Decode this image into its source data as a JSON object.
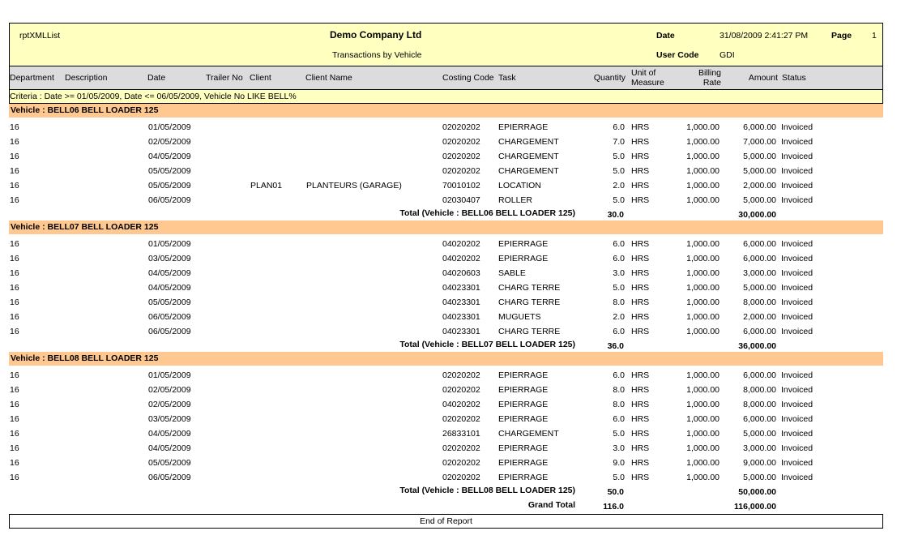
{
  "header": {
    "report_id": "rptXMLList",
    "company": "Demo Company Ltd",
    "subtitle": "Transactions by Vehicle",
    "date_label": "Date",
    "date_value": "31/08/2009 2:41:27 PM",
    "page_label": "Page",
    "page_value": "1",
    "user_label": "User Code",
    "user_value": "GDI"
  },
  "columns": {
    "department": "Department",
    "description": "Description",
    "date": "Date",
    "trailer": "Trailer No",
    "client": "Client",
    "client_name": "Client Name",
    "costing": "Costing Code",
    "task": "Task",
    "quantity": "Quantity",
    "uom_1": "Unit of",
    "uom_2": "Measure",
    "billing_1": "Billing",
    "billing_2": "Rate",
    "amount": "Amount",
    "status": "Status"
  },
  "criteria": "Criteria : Date >= 01/05/2009, Date <= 06/05/2009, Vehicle No LIKE BELL%",
  "groups": [
    {
      "title": "Vehicle : BELL06  BELL LOADER  125",
      "rows": [
        {
          "dept": "16",
          "date": "01/05/2009",
          "client": "",
          "client_name": "",
          "code": "02020202",
          "task": "EPIERRAGE",
          "qty": "6.0",
          "uom": "HRS",
          "rate": "1,000.00",
          "amount": "6,000.00",
          "status": "Invoiced"
        },
        {
          "dept": "16",
          "date": "02/05/2009",
          "client": "",
          "client_name": "",
          "code": "02020202",
          "task": "CHARGEMENT",
          "qty": "7.0",
          "uom": "HRS",
          "rate": "1,000.00",
          "amount": "7,000.00",
          "status": "Invoiced"
        },
        {
          "dept": "16",
          "date": "04/05/2009",
          "client": "",
          "client_name": "",
          "code": "02020202",
          "task": "CHARGEMENT",
          "qty": "5.0",
          "uom": "HRS",
          "rate": "1,000.00",
          "amount": "5,000.00",
          "status": "Invoiced"
        },
        {
          "dept": "16",
          "date": "05/05/2009",
          "client": "",
          "client_name": "",
          "code": "02020202",
          "task": "CHARGEMENT",
          "qty": "5.0",
          "uom": "HRS",
          "rate": "1,000.00",
          "amount": "5,000.00",
          "status": "Invoiced"
        },
        {
          "dept": "16",
          "date": "05/05/2009",
          "client": "PLAN01",
          "client_name": "PLANTEURS (GARAGE)",
          "code": "70010102",
          "task": "LOCATION",
          "qty": "2.0",
          "uom": "HRS",
          "rate": "1,000.00",
          "amount": "2,000.00",
          "status": "Invoiced"
        },
        {
          "dept": "16",
          "date": "06/05/2009",
          "client": "",
          "client_name": "",
          "code": "02030407",
          "task": "ROLLER",
          "qty": "5.0",
          "uom": "HRS",
          "rate": "1,000.00",
          "amount": "5,000.00",
          "status": "Invoiced"
        }
      ],
      "total_label": "Total (Vehicle : BELL06  BELL LOADER  125)",
      "total_qty": "30.0",
      "total_amount": "30,000.00"
    },
    {
      "title": "Vehicle : BELL07  BELL LOADER  125",
      "rows": [
        {
          "dept": "16",
          "date": "01/05/2009",
          "client": "",
          "client_name": "",
          "code": "04020202",
          "task": "EPIERRAGE",
          "qty": "6.0",
          "uom": "HRS",
          "rate": "1,000.00",
          "amount": "6,000.00",
          "status": "Invoiced"
        },
        {
          "dept": "16",
          "date": "03/05/2009",
          "client": "",
          "client_name": "",
          "code": "04020202",
          "task": "EPIERRAGE",
          "qty": "6.0",
          "uom": "HRS",
          "rate": "1,000.00",
          "amount": "6,000.00",
          "status": "Invoiced"
        },
        {
          "dept": "16",
          "date": "04/05/2009",
          "client": "",
          "client_name": "",
          "code": "04020603",
          "task": "SABLE",
          "qty": "3.0",
          "uom": "HRS",
          "rate": "1,000.00",
          "amount": "3,000.00",
          "status": "Invoiced"
        },
        {
          "dept": "16",
          "date": "04/05/2009",
          "client": "",
          "client_name": "",
          "code": "04023301",
          "task": "CHARG TERRE",
          "qty": "5.0",
          "uom": "HRS",
          "rate": "1,000.00",
          "amount": "5,000.00",
          "status": "Invoiced"
        },
        {
          "dept": "16",
          "date": "05/05/2009",
          "client": "",
          "client_name": "",
          "code": "04023301",
          "task": "CHARG TERRE",
          "qty": "8.0",
          "uom": "HRS",
          "rate": "1,000.00",
          "amount": "8,000.00",
          "status": "Invoiced"
        },
        {
          "dept": "16",
          "date": "06/05/2009",
          "client": "",
          "client_name": "",
          "code": "04023301",
          "task": "MUGUETS",
          "qty": "2.0",
          "uom": "HRS",
          "rate": "1,000.00",
          "amount": "2,000.00",
          "status": "Invoiced"
        },
        {
          "dept": "16",
          "date": "06/05/2009",
          "client": "",
          "client_name": "",
          "code": "04023301",
          "task": "CHARG TERRE",
          "qty": "6.0",
          "uom": "HRS",
          "rate": "1,000.00",
          "amount": "6,000.00",
          "status": "Invoiced"
        }
      ],
      "total_label": "Total (Vehicle : BELL07  BELL LOADER  125)",
      "total_qty": "36.0",
      "total_amount": "36,000.00"
    },
    {
      "title": "Vehicle : BELL08  BELL LOADER  125",
      "rows": [
        {
          "dept": "16",
          "date": "01/05/2009",
          "client": "",
          "client_name": "",
          "code": "02020202",
          "task": "EPIERRAGE",
          "qty": "6.0",
          "uom": "HRS",
          "rate": "1,000.00",
          "amount": "6,000.00",
          "status": "Invoiced"
        },
        {
          "dept": "16",
          "date": "02/05/2009",
          "client": "",
          "client_name": "",
          "code": "02020202",
          "task": "EPIERRAGE",
          "qty": "8.0",
          "uom": "HRS",
          "rate": "1,000.00",
          "amount": "8,000.00",
          "status": "Invoiced"
        },
        {
          "dept": "16",
          "date": "02/05/2009",
          "client": "",
          "client_name": "",
          "code": "04020202",
          "task": "EPIERRAGE",
          "qty": "8.0",
          "uom": "HRS",
          "rate": "1,000.00",
          "amount": "8,000.00",
          "status": "Invoiced"
        },
        {
          "dept": "16",
          "date": "03/05/2009",
          "client": "",
          "client_name": "",
          "code": "02020202",
          "task": "EPIERRAGE",
          "qty": "6.0",
          "uom": "HRS",
          "rate": "1,000.00",
          "amount": "6,000.00",
          "status": "Invoiced"
        },
        {
          "dept": "16",
          "date": "04/05/2009",
          "client": "",
          "client_name": "",
          "code": "26833101",
          "task": "CHARGEMENT",
          "qty": "5.0",
          "uom": "HRS",
          "rate": "1,000.00",
          "amount": "5,000.00",
          "status": "Invoiced"
        },
        {
          "dept": "16",
          "date": "04/05/2009",
          "client": "",
          "client_name": "",
          "code": "02020202",
          "task": "EPIERRAGE",
          "qty": "3.0",
          "uom": "HRS",
          "rate": "1,000.00",
          "amount": "3,000.00",
          "status": "Invoiced"
        },
        {
          "dept": "16",
          "date": "05/05/2009",
          "client": "",
          "client_name": "",
          "code": "02020202",
          "task": "EPIERRAGE",
          "qty": "9.0",
          "uom": "HRS",
          "rate": "1,000.00",
          "amount": "9,000.00",
          "status": "Invoiced"
        },
        {
          "dept": "16",
          "date": "06/05/2009",
          "client": "",
          "client_name": "",
          "code": "02020202",
          "task": "EPIERRAGE",
          "qty": "5.0",
          "uom": "HRS",
          "rate": "1,000.00",
          "amount": "5,000.00",
          "status": "Invoiced"
        }
      ],
      "total_label": "Total (Vehicle : BELL08  BELL LOADER  125)",
      "total_qty": "50.0",
      "total_amount": "50,000.00"
    }
  ],
  "grand_total_label": "Grand Total",
  "grand_total_qty": "116.0",
  "grand_total_amount": "116,000.00",
  "footer": "End of Report",
  "colors": {
    "header_bg": "#ffffc0",
    "column_header_bg": "#dcdcdc",
    "vehicle_band_bg": "#ffc891"
  }
}
